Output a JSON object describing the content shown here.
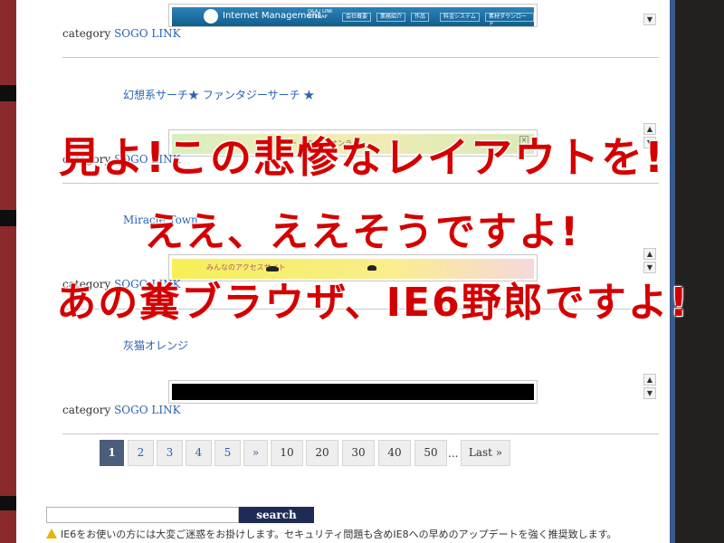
{
  "colors": {
    "link": "#2a63b4",
    "overlay_red": "#d40000",
    "current_page_bg": "#4a5d79",
    "search_button_bg": "#1e2c55"
  },
  "entries": [
    {
      "banner": {
        "title": "Internet Management",
        "subtitle": "Q&A | LINK SITEMAP",
        "tabs": [
          "会社概要",
          "業務紹介",
          "作品",
          "料金システム",
          "素材ダウンロード"
        ]
      },
      "category_label": "category",
      "category_link": "SOGO LINK"
    },
    {
      "site_link": "幻想系サーチ★ ファンタジーサーチ ★",
      "banner": {
        "text": "ー ハの曲 ーオンライ",
        "close": "×"
      },
      "category_label": "category",
      "category_link": "SOGO LINK"
    },
    {
      "site_link": "Miracle Town",
      "banner": {
        "text": "みんなのアクセスサイト"
      },
      "category_label": "category",
      "category_link": "SOGO LINK"
    },
    {
      "site_link": "灰猫オレンジ",
      "category_label": "category",
      "category_link": "SOGO LINK"
    }
  ],
  "scroller": {
    "up": "▲",
    "down": "▼",
    "up_icon": "scroll-up-icon",
    "down_icon": "scroll-down-icon"
  },
  "pagination": {
    "current": "1",
    "pages": [
      "2",
      "3",
      "4",
      "5"
    ],
    "next": "»",
    "jumps": [
      "10",
      "20",
      "30",
      "40",
      "50"
    ],
    "ellipsis": "...",
    "last": "Last »"
  },
  "search": {
    "value": "",
    "placeholder": "",
    "button_label": "search"
  },
  "warning": {
    "icon": "warning-icon",
    "text": "IE6をお使いの方には大変ご迷惑をお掛けします。セキュリティ問題も含めIE8への早めのアップデートを強く推奨致します。"
  },
  "overlay": {
    "line1": "見よ!この悲惨なレイアウトを!",
    "line2": "ええ、ええそうですよ!",
    "line3": "あの糞ブラウザ、IE6野郎ですよ!"
  }
}
